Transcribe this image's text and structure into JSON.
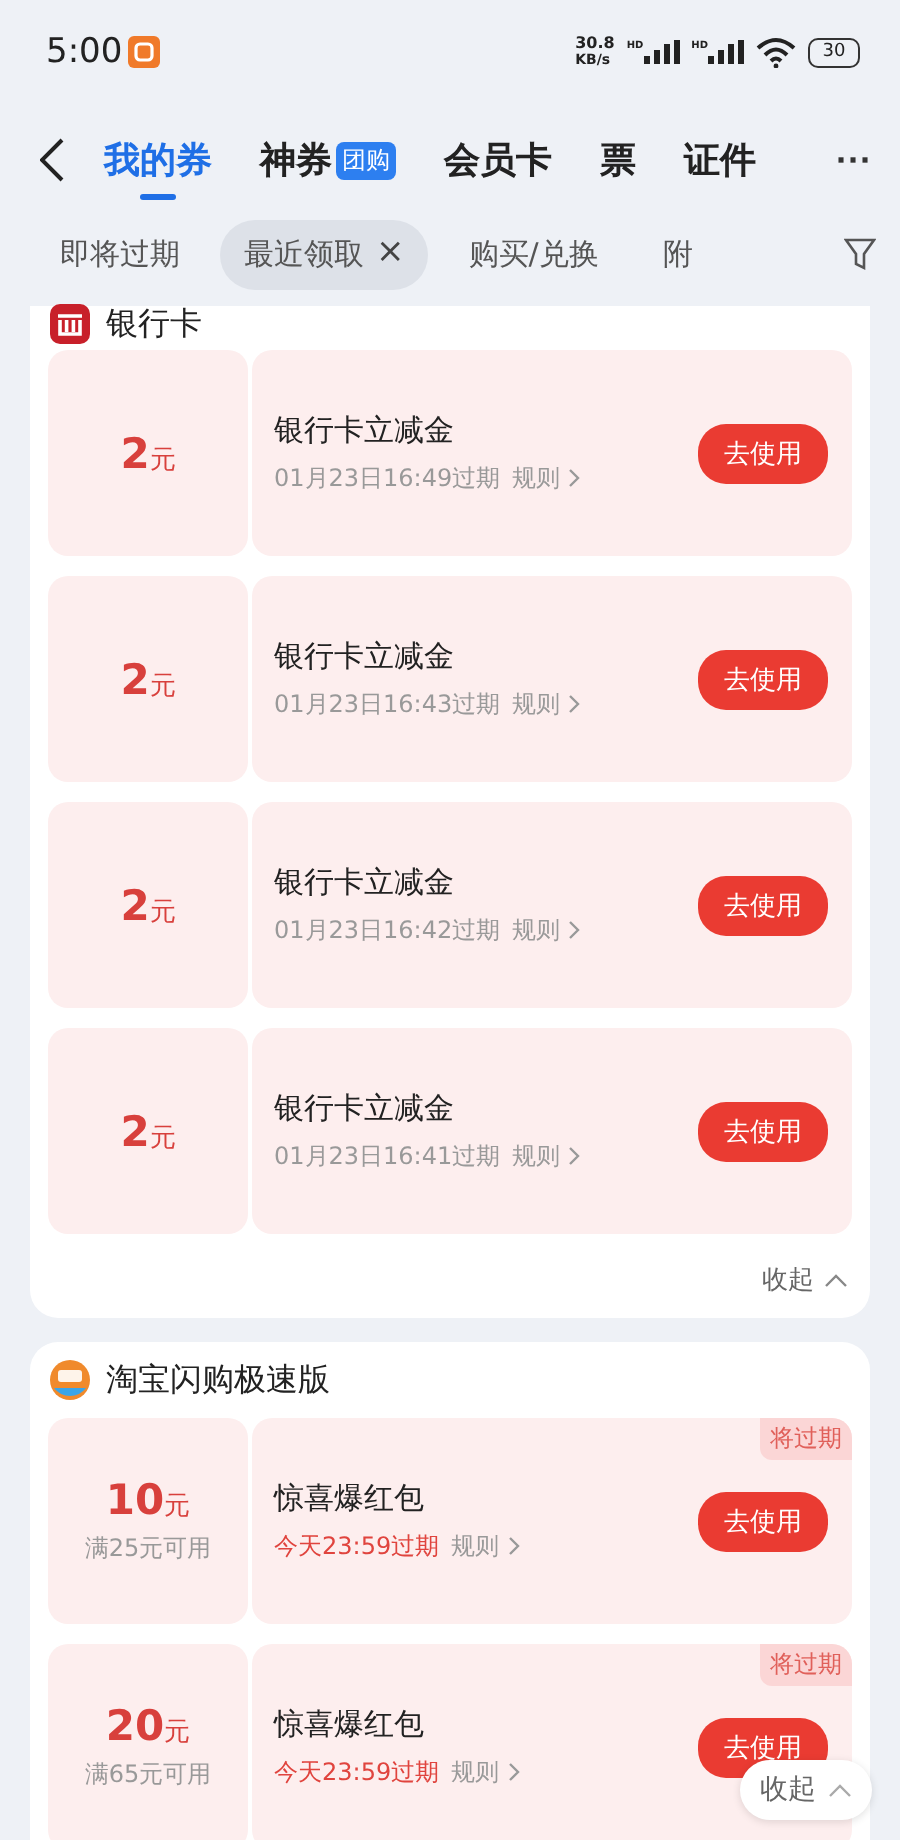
{
  "status_bar": {
    "time": "5:00",
    "speed_value": "30.8",
    "speed_unit": "KB/s",
    "network_labels": [
      "HD",
      "HD"
    ],
    "battery": "30"
  },
  "nav": {
    "tabs": [
      {
        "label": "我的券",
        "selected": true
      },
      {
        "label": "神券",
        "badge": "团购",
        "selected": false
      },
      {
        "label": "会员卡",
        "selected": false
      },
      {
        "label": "票",
        "selected": false
      },
      {
        "label": "证件",
        "selected": false
      }
    ],
    "more": "···"
  },
  "filters": [
    {
      "label": "即将过期",
      "selected": false
    },
    {
      "label": "最近领取",
      "selected": true,
      "clear": "×"
    },
    {
      "label": "购买/兑换",
      "selected": false
    },
    {
      "label": "附",
      "selected": false
    }
  ],
  "sections": [
    {
      "title": "银行卡",
      "kind": "bank",
      "collapse": "收起",
      "coupons": [
        {
          "amount": "2",
          "unit": "元",
          "name": "银行卡立减金",
          "expiry": "01月23日16:49过期",
          "urgent": false,
          "rules": "规则",
          "button": "去使用"
        },
        {
          "amount": "2",
          "unit": "元",
          "name": "银行卡立减金",
          "expiry": "01月23日16:43过期",
          "urgent": false,
          "rules": "规则",
          "button": "去使用"
        },
        {
          "amount": "2",
          "unit": "元",
          "name": "银行卡立减金",
          "expiry": "01月23日16:42过期",
          "urgent": false,
          "rules": "规则",
          "button": "去使用"
        },
        {
          "amount": "2",
          "unit": "元",
          "name": "银行卡立减金",
          "expiry": "01月23日16:41过期",
          "urgent": false,
          "rules": "规则",
          "button": "去使用"
        }
      ]
    },
    {
      "title": "淘宝闪购极速版",
      "kind": "shop",
      "coupons": [
        {
          "amount": "10",
          "unit": "元",
          "condition": "满25元可用",
          "name": "惊喜爆红包",
          "expiry": "今天23:59过期",
          "urgent": true,
          "rules": "规则",
          "button": "去使用",
          "tag": "将过期"
        },
        {
          "amount": "20",
          "unit": "元",
          "condition": "满65元可用",
          "name": "惊喜爆红包",
          "expiry": "今天23:59过期",
          "urgent": true,
          "rules": "规则",
          "button": "去使用",
          "tag": "将过期"
        }
      ]
    }
  ],
  "floating_collapse": "收起"
}
